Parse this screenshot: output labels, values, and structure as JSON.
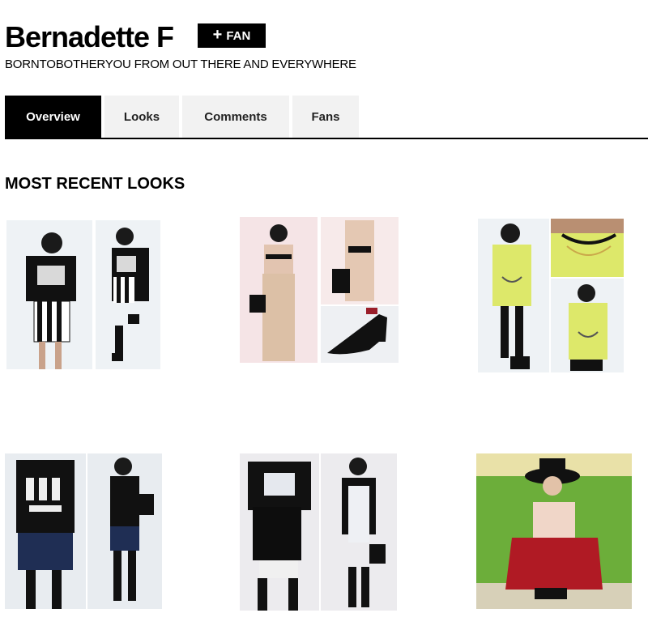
{
  "profile": {
    "name": "Bernadette F",
    "fan_button": {
      "icon": "plus-icon",
      "label": "FAN"
    },
    "tagline": "BORNTOBOTHERYOU FROM OUT THERE AND EVERYWHERE"
  },
  "tabs": [
    {
      "label": "Overview",
      "active": true
    },
    {
      "label": "Looks",
      "active": false
    },
    {
      "label": "Comments",
      "active": false
    },
    {
      "label": "Fans",
      "active": false
    }
  ],
  "recent_looks": {
    "title": "MOST RECENT LOOKS",
    "items": [
      {
        "description": "two photos: black crop top, striped skirt"
      },
      {
        "description": "three photos: harness top, beige pants, black heel"
      },
      {
        "description": "three photos: yellow sweater with choker"
      },
      {
        "description": "two photos: graphic tank, black skirt, backpack"
      },
      {
        "description": "two photos: white dress, black jacket, backpack"
      },
      {
        "description": "one photo: black hat, red skirt, grass field"
      }
    ]
  }
}
